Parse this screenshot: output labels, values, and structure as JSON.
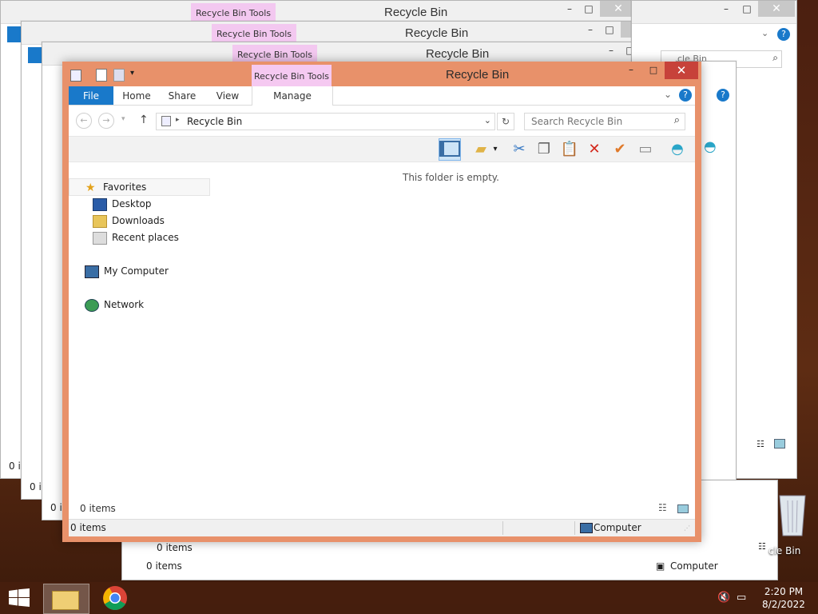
{
  "window": {
    "title": "Recycle Bin",
    "context_tab": "Recycle Bin Tools",
    "minimize": "–",
    "maximize": "□",
    "close": "✕"
  },
  "ribbon_tabs": [
    "File",
    "Home",
    "Share",
    "View",
    "Manage"
  ],
  "address": {
    "location": "Recycle Bin",
    "search_placeholder": "Search Recycle Bin"
  },
  "nav_pane": {
    "favorites": "Favorites",
    "desktop": "Desktop",
    "downloads": "Downloads",
    "recent_places": "Recent places",
    "my_computer": "My Computer",
    "network": "Network"
  },
  "content": {
    "empty_message": "This folder is empty."
  },
  "status": {
    "items_top": "0 items",
    "items_bar": "0 items",
    "location": "Computer"
  },
  "background_windows": {
    "title": "Recycle Bin",
    "context_tab": "Recycle Bin Tools",
    "status_items": "0 items",
    "status_partial": "0 ite",
    "status_location": "Computer",
    "search_partial": "cle Bin",
    "desktop_label_partial": "cle Bin"
  },
  "taskbar": {
    "time": "2:20 PM",
    "date": "8/2/2022"
  },
  "colors": {
    "accent_border": "#e8916a",
    "file_tab": "#1979ca",
    "context_tab_bg": "#f5c9f1",
    "close_button": "#c7423a"
  }
}
